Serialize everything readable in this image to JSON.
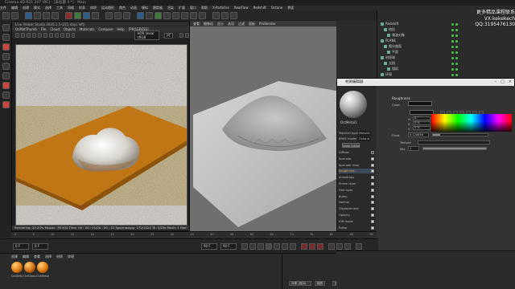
{
  "window": {
    "title": "Cinema 4D R21.207 (RC) - [未标题 4 *] - Main"
  },
  "menubar": {
    "items": [
      "文件",
      "编辑",
      "创建",
      "模式",
      "选择",
      "工具",
      "网格",
      "样条",
      "体积",
      "运动图形",
      "角色",
      "动画",
      "模拟",
      "跟踪器",
      "渲染",
      "扩展",
      "窗口",
      "帮助",
      "X-Particles",
      "RealFlow",
      "Redshift",
      "Octane",
      "界面"
    ]
  },
  "ivr": {
    "title": "Live Viewer Studio 2020.1.5 (215 days left)",
    "menu": [
      "OcMatThumb",
      "File",
      "Cloud",
      "Objects",
      "Materials",
      "Compare",
      "Help",
      "[PROGRESS]"
    ],
    "hdr_label": "HDR linear sRGB",
    "pt_label": "PT",
    "status": "Rendering: 23.20%  Ms/sec: 78.504  Time: 00 : 00 : 01/00 : 00 : 01  Spp/maxspp: 172/1024  Tri: 0/25k  Mesh: 1  Hair: 0  RTXon  GPU: 49"
  },
  "viewport": {
    "menu": [
      "查看",
      "摄像机",
      "显示",
      "选项",
      "过滤",
      "面板",
      "ProRender"
    ]
  },
  "objects": {
    "rows": [
      "Redshift",
      "地形",
      "噪波对象",
      "PLANE",
      "细分曲面",
      "平面",
      "材质球",
      "太阳",
      "相机",
      "环境"
    ]
  },
  "watermark": {
    "line1": "更多精品课程联系",
    "line2": "VX:kekekech",
    "line3": "QQ:3195476130"
  },
  "material_editor": {
    "title": "材质编辑器",
    "material_name": "OctMetal1",
    "material_type_label": "Material type",
    "material_type_value": "Metallic",
    "brdf_label": "BRDF model",
    "brdf_value": "Octane",
    "node_editor": "Node Editor",
    "channels": [
      {
        "label": "Diffuse",
        "checked": false
      },
      {
        "label": "Specular",
        "checked": true
      },
      {
        "label": "Specular map",
        "checked": true
      },
      {
        "label": "Roughness",
        "checked": true,
        "selected": true
      },
      {
        "label": "Anisotropy",
        "checked": true
      },
      {
        "label": "Sheen layer",
        "checked": true
      },
      {
        "label": "Film layer",
        "checked": true
      },
      {
        "label": "Bump",
        "checked": true
      },
      {
        "label": "Normal",
        "checked": true
      },
      {
        "label": "Displacement",
        "checked": true
      },
      {
        "label": "Opacity",
        "checked": true
      },
      {
        "label": "IOR mode",
        "checked": true
      },
      {
        "label": "Editor",
        "checked": true
      },
      {
        "label": "Common",
        "checked": true
      },
      {
        "label": "Editor",
        "checked": true
      }
    ],
    "section": "Roughness",
    "color_label": "Color",
    "hsv": [
      {
        "label": "H",
        "value": "0 °"
      },
      {
        "label": "S",
        "value": "0 %"
      },
      {
        "label": "V",
        "value": "0 %"
      }
    ],
    "float_label": "Float",
    "float_value": "0.124604",
    "texture_label": "Texture",
    "mix_label": "Mix",
    "mix_value": "1"
  },
  "timeline": {
    "ticks": [
      "0",
      "5",
      "10",
      "15",
      "20",
      "25",
      "30",
      "35",
      "40",
      "45",
      "50",
      "55",
      "60",
      "65",
      "70",
      "75",
      "80",
      "85",
      "90"
    ]
  },
  "transport": {
    "start": "0 F",
    "current": "0 F",
    "end": "90 F",
    "end2": "90 F"
  },
  "material_manager": {
    "menu": [
      "创建",
      "编辑",
      "查看",
      "选择",
      "材质",
      "纹理"
    ],
    "materials": [
      "OctDiffu",
      "OctGloss",
      "OctMetal"
    ]
  },
  "attributes": {
    "buttons": [
      "应用",
      "坐标",
      "缩放"
    ],
    "label": "对象 (相对)"
  }
}
